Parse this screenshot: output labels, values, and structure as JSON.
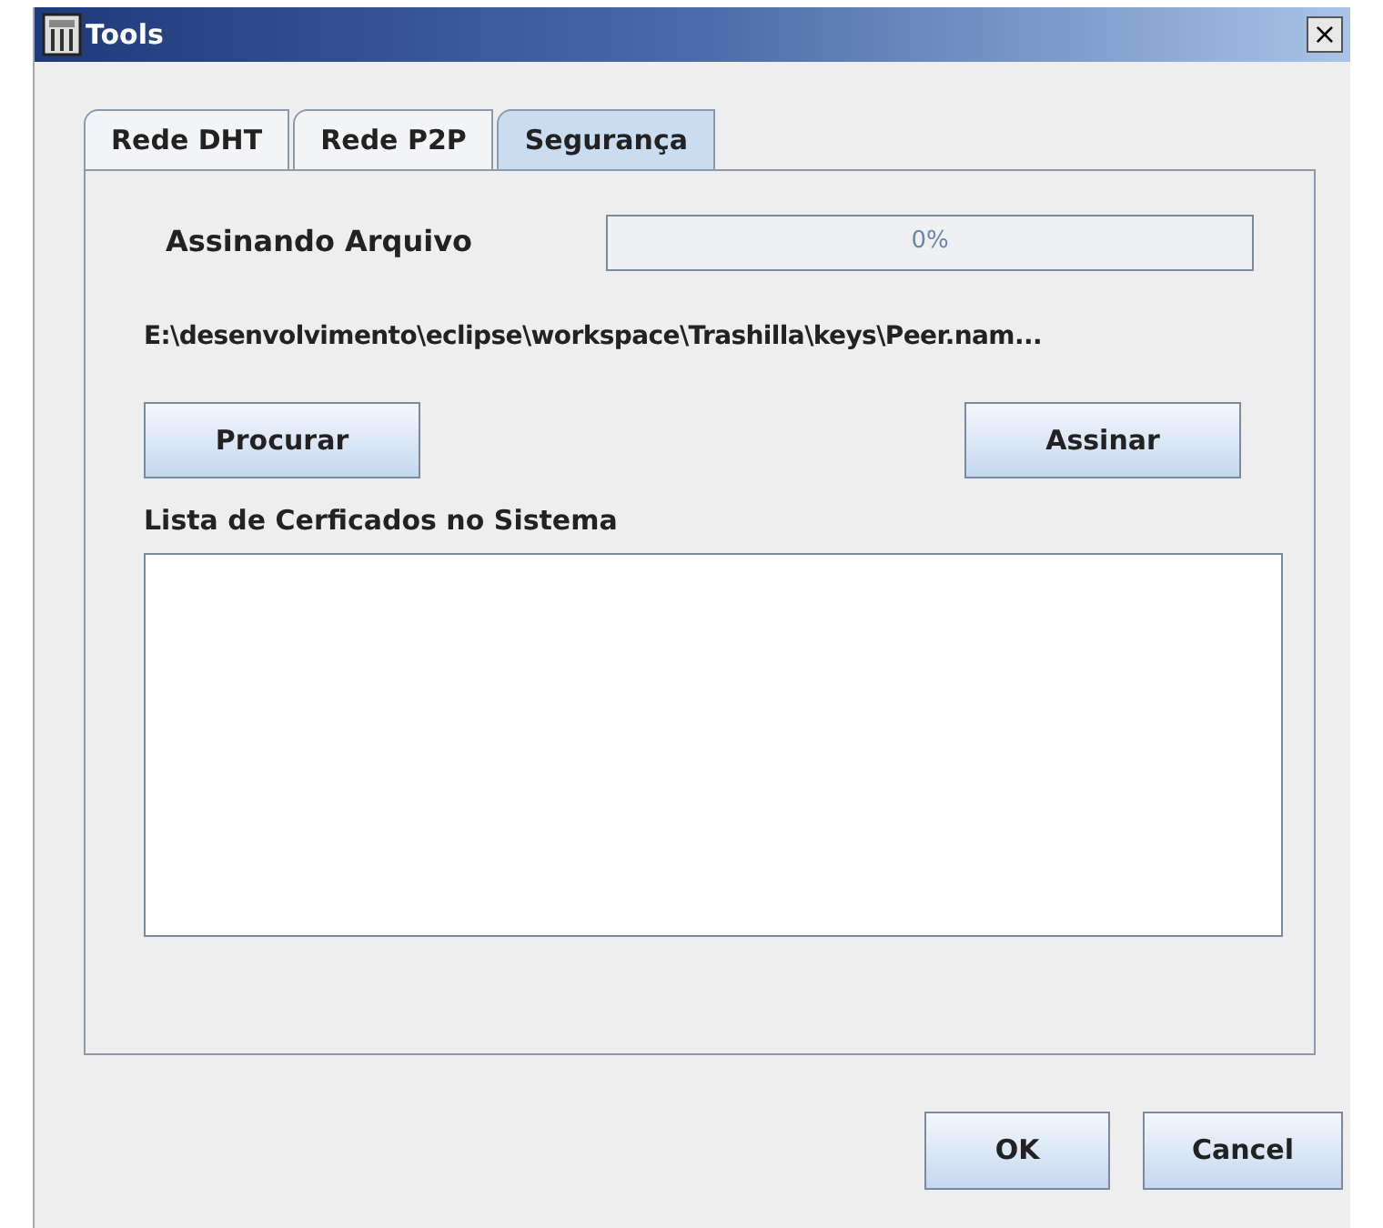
{
  "window": {
    "title": "Tools",
    "close": "×"
  },
  "tabs": [
    {
      "label": "Rede DHT",
      "selected": false
    },
    {
      "label": "Rede P2P",
      "selected": false
    },
    {
      "label": "Segurança",
      "selected": true
    }
  ],
  "progress": {
    "label": "Assinando Arquivo",
    "level": 0,
    "reading": "0%"
  },
  "file_path": "E:\\desenvolvimento\\eclipse\\workspace\\Trashilla\\keys\\Peer.nam...",
  "browse_button": "Procurar",
  "sign_button": "Assinar",
  "list": {
    "label": "Lista de Cerficados no Sistema"
  },
  "buttons": [
    "OK",
    "Cancel"
  ]
}
